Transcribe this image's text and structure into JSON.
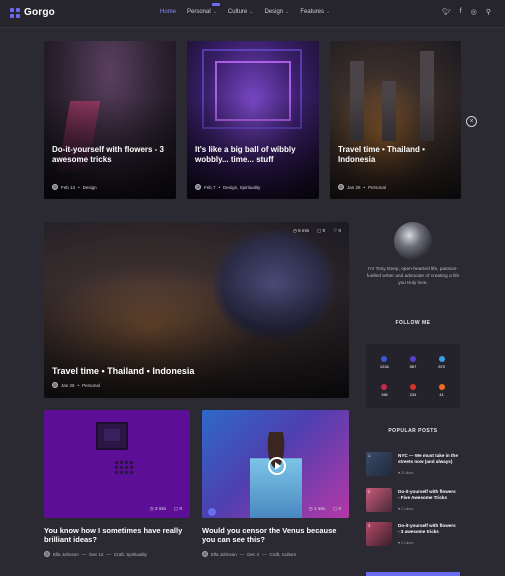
{
  "header": {
    "logo": "Gorgo",
    "nav": [
      {
        "label": "Home",
        "active": true,
        "dropdown": false
      },
      {
        "label": "Personal",
        "active": false,
        "dropdown": true
      },
      {
        "label": "Culture",
        "active": false,
        "dropdown": true
      },
      {
        "label": "Design",
        "active": false,
        "dropdown": true
      },
      {
        "label": "Features",
        "active": false,
        "dropdown": true
      }
    ],
    "social_icons": [
      "twitter-icon",
      "facebook-icon",
      "instagram-icon",
      "search-icon"
    ]
  },
  "featured": [
    {
      "title": "Do-it-yourself with flowers - 3 awesome tricks",
      "date": "Feb 13",
      "category": "Design"
    },
    {
      "title": "It's like a big ball of wibbly wobbly... time... stuff",
      "date": "Feb 7",
      "category": "Design, Spirituality"
    },
    {
      "title": "Travel time • Thailand • Indonesia",
      "date": "Jan 26",
      "category": "Personal"
    }
  ],
  "main_post": {
    "title": "Travel time • Thailand • Indonesia",
    "date": "Jan 26",
    "category": "Personal",
    "reading": "5 min",
    "comments": "0",
    "likes": "0"
  },
  "grid_posts": [
    {
      "title": "You know how I sometimes have really brilliant ideas?",
      "author": "Ella Johnson",
      "date": "Dec 12",
      "category": "Craft, Spirituality",
      "reading": "3 min",
      "comments": "0"
    },
    {
      "title": "Would you censor the Venus because you can see this?",
      "author": "Ella Johnson",
      "date": "Dec 4",
      "category": "Craft, Culture",
      "reading": "1 min",
      "comments": "0"
    }
  ],
  "sidebar": {
    "bio": "I'm Tony Deep, open-hearted life, passion-fuelled writer and advocate of creating a life you truly love.",
    "follow_title": "FOLLOW ME",
    "follow": [
      {
        "network": "Facebook",
        "count": "1234",
        "color": "#3b5bd6"
      },
      {
        "network": "Instagram",
        "count": "567",
        "color": "#5a40c8"
      },
      {
        "network": "Twitter",
        "count": "870",
        "color": "#3a9be8"
      },
      {
        "network": "Pinterest",
        "count": "198",
        "color": "#c8284a"
      },
      {
        "network": "YouTube",
        "count": "234",
        "color": "#d8342a"
      },
      {
        "network": "SoundCloud",
        "count": "41",
        "color": "#f06a20"
      }
    ],
    "popular_title": "POPULAR POSTS",
    "popular": [
      {
        "num": "1",
        "title": "NYC — We must take in the streets now (and always)",
        "likes": "♥ 3 Likes"
      },
      {
        "num": "2",
        "title": "Do-it-yourself with flowers - Five Awesome Tricks",
        "likes": "♥ 2 Likes"
      },
      {
        "num": "3",
        "title": "Do-it-yourself with flowers - 3 awesome tricks",
        "likes": "♥ 2 Likes"
      }
    ]
  },
  "colors": {
    "accent": "#6a6cf0",
    "background": "#2b2a33"
  }
}
